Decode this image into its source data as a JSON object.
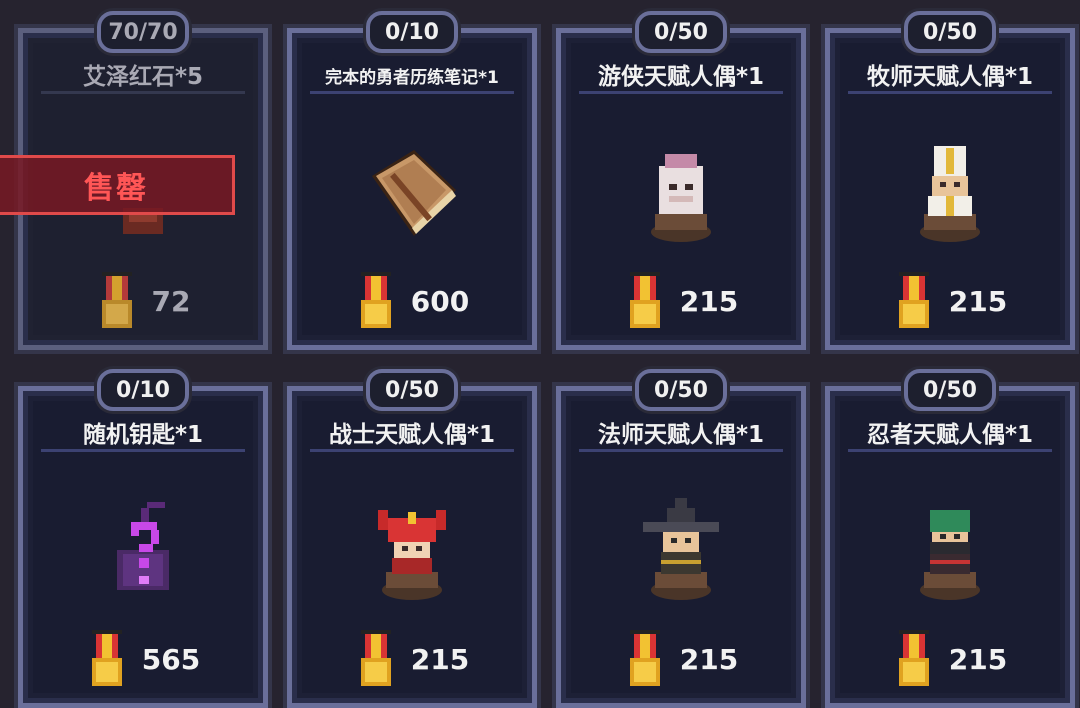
{
  "items": [
    {
      "counter": "70/70",
      "name": "艾泽红石*5",
      "price": "72",
      "sold_label": "售罄"
    },
    {
      "counter": "0/10",
      "name": "完本的勇者历练笔记*1",
      "price": "600"
    },
    {
      "counter": "0/50",
      "name": "游侠天赋人偶*1",
      "price": "215"
    },
    {
      "counter": "0/50",
      "name": "牧师天赋人偶*1",
      "price": "215"
    },
    {
      "counter": "0/10",
      "name": "随机钥匙*1",
      "price": "565"
    },
    {
      "counter": "0/50",
      "name": "战士天赋人偶*1",
      "price": "215"
    },
    {
      "counter": "0/50",
      "name": "法师天赋人偶*1",
      "price": "215"
    },
    {
      "counter": "0/50",
      "name": "忍者天赋人偶*1",
      "price": "215"
    }
  ],
  "icons": {
    "currency": "medal-icon",
    "item_0": "red-stone-icon",
    "item_1": "book-icon",
    "item_2": "ranger-doll-icon",
    "item_3": "priest-doll-icon",
    "item_4": "mystery-key-icon",
    "item_5": "warrior-doll-icon",
    "item_6": "mage-doll-icon",
    "item_7": "ninja-doll-icon"
  }
}
